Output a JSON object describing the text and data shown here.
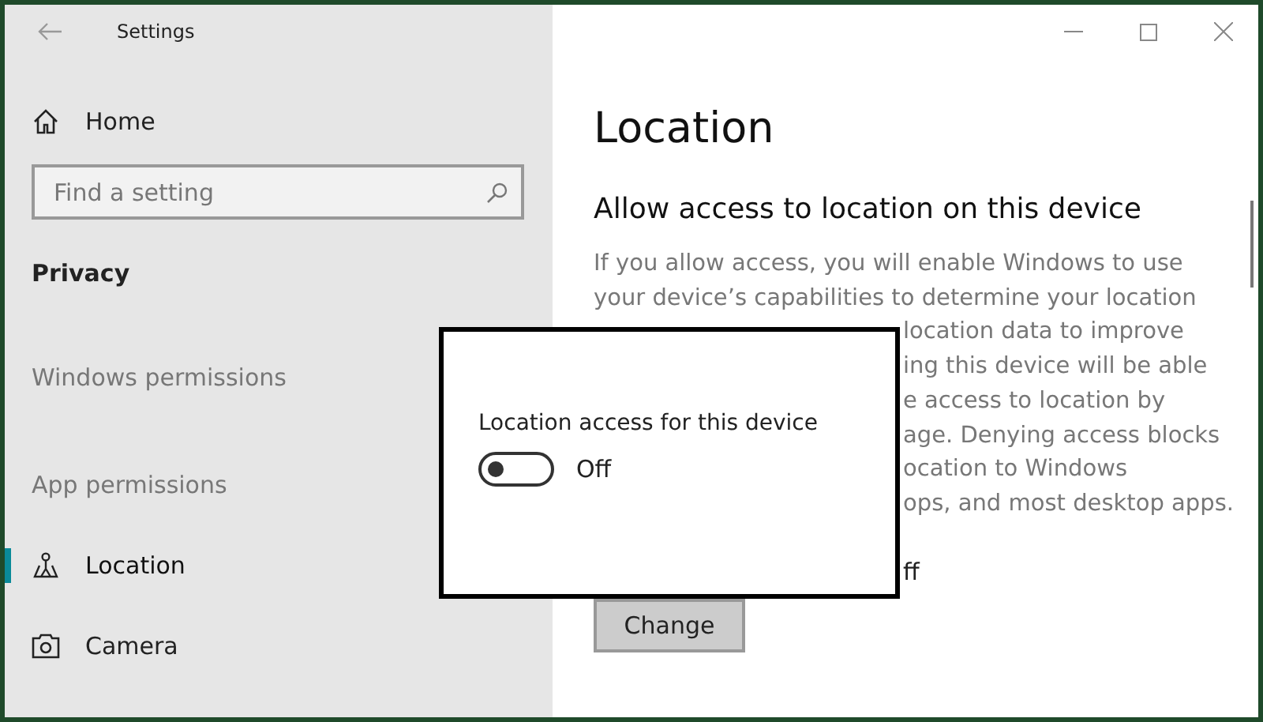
{
  "window": {
    "title": "Settings"
  },
  "sidebar": {
    "home": "Home",
    "search": {
      "placeholder": "Find a setting"
    },
    "section": "Privacy",
    "groups": [
      {
        "kind": "header",
        "label": "Windows permissions"
      },
      {
        "kind": "header",
        "label": "App permissions"
      },
      {
        "kind": "item",
        "label": "Location",
        "selected": true
      },
      {
        "kind": "item",
        "label": "Camera",
        "selected": false
      }
    ]
  },
  "content": {
    "title": "Location",
    "heading": "Allow access to location on this device",
    "paragraph_lines": [
      "If you allow access, you will enable Windows to use",
      "your device’s capabilities to determine your location"
    ],
    "covered_fragments": [
      "location data to improve",
      "ing this device will be able",
      "e access to location by",
      "age. Denying access blocks",
      "ocation to Windows",
      "ops, and most desktop apps."
    ],
    "status_fragment": "ff",
    "button": "Change"
  },
  "popup": {
    "label": "Location access for this device",
    "toggle": {
      "on": false,
      "text": "Off"
    }
  }
}
